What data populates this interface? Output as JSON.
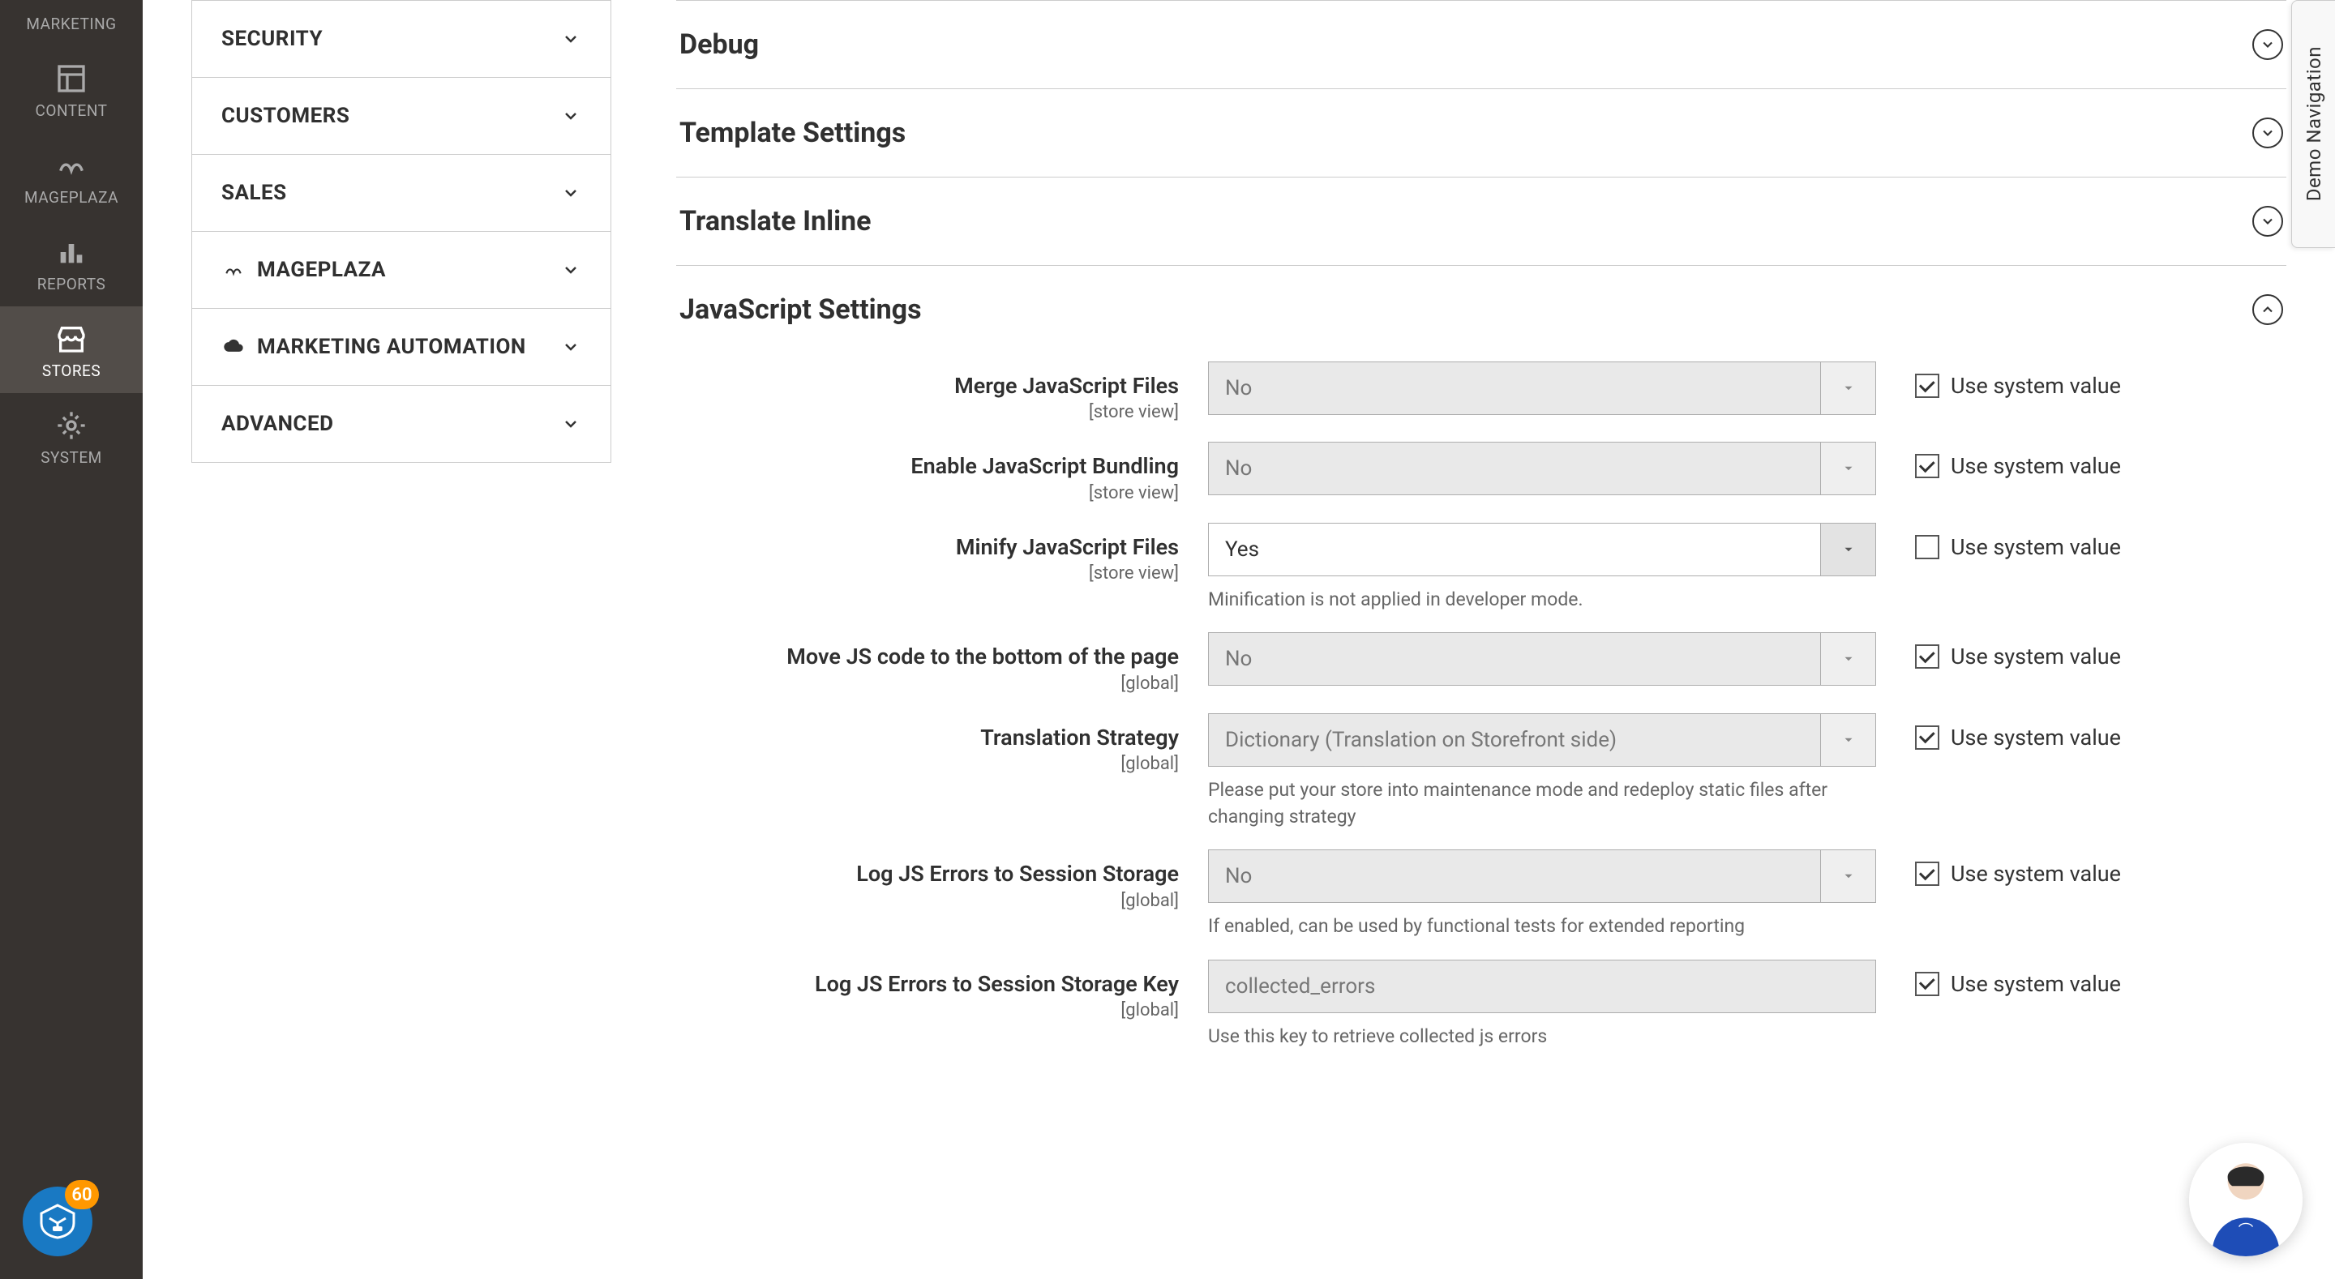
{
  "leftnav": {
    "items": [
      {
        "key": "marketing",
        "label": "MARKETING"
      },
      {
        "key": "content",
        "label": "CONTENT"
      },
      {
        "key": "mageplaza",
        "label": "MAGEPLAZA"
      },
      {
        "key": "reports",
        "label": "REPORTS"
      },
      {
        "key": "stores",
        "label": "STORES",
        "active": true
      },
      {
        "key": "system",
        "label": "SYSTEM"
      }
    ],
    "help_count": "60"
  },
  "config_tabs": [
    {
      "label": "SECURITY"
    },
    {
      "label": "CUSTOMERS"
    },
    {
      "label": "SALES"
    },
    {
      "label": "MAGEPLAZA",
      "icon": "mageplaza"
    },
    {
      "label": "MARKETING AUTOMATION",
      "icon": "dotmailer"
    },
    {
      "label": "ADVANCED"
    }
  ],
  "sections": {
    "debug": {
      "title": "Debug"
    },
    "template": {
      "title": "Template Settings"
    },
    "translate": {
      "title": "Translate Inline"
    },
    "js": {
      "title": "JavaScript Settings"
    }
  },
  "fields": {
    "merge": {
      "label": "Merge JavaScript Files",
      "scope": "[store view]",
      "value": "No",
      "use_system": true
    },
    "bundling": {
      "label": "Enable JavaScript Bundling",
      "scope": "[store view]",
      "value": "No",
      "use_system": true
    },
    "minify": {
      "label": "Minify JavaScript Files",
      "scope": "[store view]",
      "value": "Yes",
      "use_system": false,
      "note": "Minification is not applied in developer mode."
    },
    "movejs": {
      "label": "Move JS code to the bottom of the page",
      "scope": "[global]",
      "value": "No",
      "use_system": true
    },
    "translation": {
      "label": "Translation Strategy",
      "scope": "[global]",
      "value": "Dictionary (Translation on Storefront side)",
      "use_system": true,
      "note": "Please put your store into maintenance mode and redeploy static files after changing strategy"
    },
    "logerr": {
      "label": "Log JS Errors to Session Storage",
      "scope": "[global]",
      "value": "No",
      "use_system": true,
      "note": "If enabled, can be used by functional tests for extended reporting"
    },
    "logkey": {
      "label": "Log JS Errors to Session Storage Key",
      "scope": "[global]",
      "value": "collected_errors",
      "use_system": true,
      "note": "Use this key to retrieve collected js errors"
    }
  },
  "labels": {
    "use_system": "Use system value",
    "demo_nav": "Demo Navigation"
  }
}
